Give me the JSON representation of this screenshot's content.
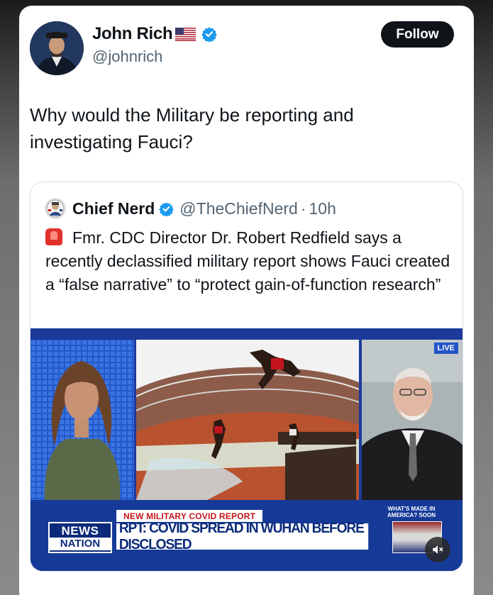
{
  "author": {
    "name": "John Rich",
    "handle": "@johnrich",
    "flag_icon": "us-flag-icon",
    "verified_icon": "verified-badge-icon"
  },
  "follow_label": "Follow",
  "tweet_text": "Why would the Military be reporting and investigating Fauci?",
  "quoted": {
    "name": "Chief Nerd",
    "handle": "@TheChiefNerd",
    "separator": "·",
    "time": "10h",
    "text": "Fmr. CDC Director Dr. Robert Redfield says a recently declassified military report shows Fauci created a “false narrative” to “protect gain-of-function research”",
    "siren_icon": "siren-icon",
    "media": {
      "live_badge": "LIVE",
      "lower_third_label": "NEW MILITARY COVID REPORT",
      "headline": "RPT: COVID SPREAD IN WUHAN BEFORE DISCLOSED",
      "logo_top": "NEWS",
      "logo_bottom": "NATION",
      "promo_text": "WHAT'S MADE IN AMERICA? SOON",
      "mute_icon": "muted-speaker-icon"
    }
  },
  "colors": {
    "verified": "#1d9bf0",
    "follow_bg": "#0f1419",
    "handle": "#536471",
    "news_blue": "#163a98",
    "headline_red": "#c4141b"
  }
}
